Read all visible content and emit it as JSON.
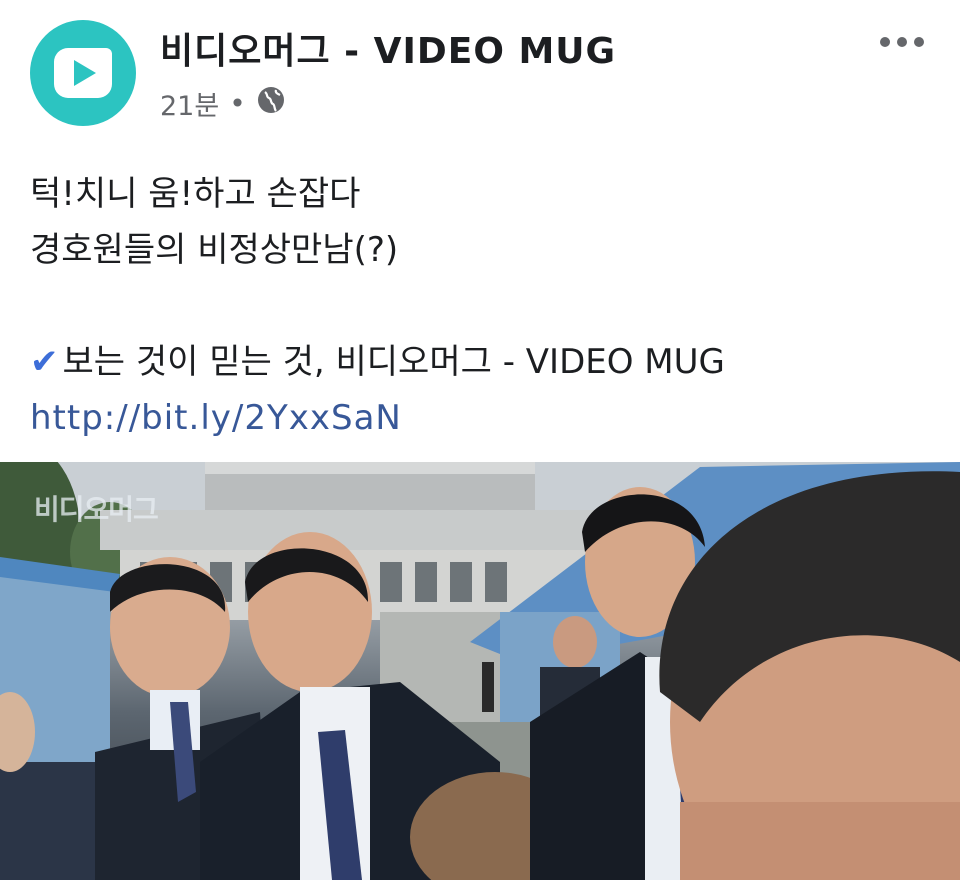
{
  "post": {
    "page_name": "비디오머그 - VIDEO MUG",
    "time": "21분",
    "separator": "•",
    "audience_icon": "globe-icon",
    "more_icon": "more-dots-icon",
    "text_lines": [
      "턱!치니 움!하고 손잡다",
      "경호원들의 비정상만남(?)"
    ],
    "tagline_check": "✔",
    "tagline": "보는 것이 믿는 것, 비디오머그 - VIDEO MUG",
    "link": "http://bit.ly/2YxxSaN"
  },
  "video": {
    "watermark": "비디오머그"
  },
  "colors": {
    "avatar": "#2cc4c1",
    "link": "#385898",
    "check": "#3d6ed8",
    "meta": "#65676b"
  }
}
